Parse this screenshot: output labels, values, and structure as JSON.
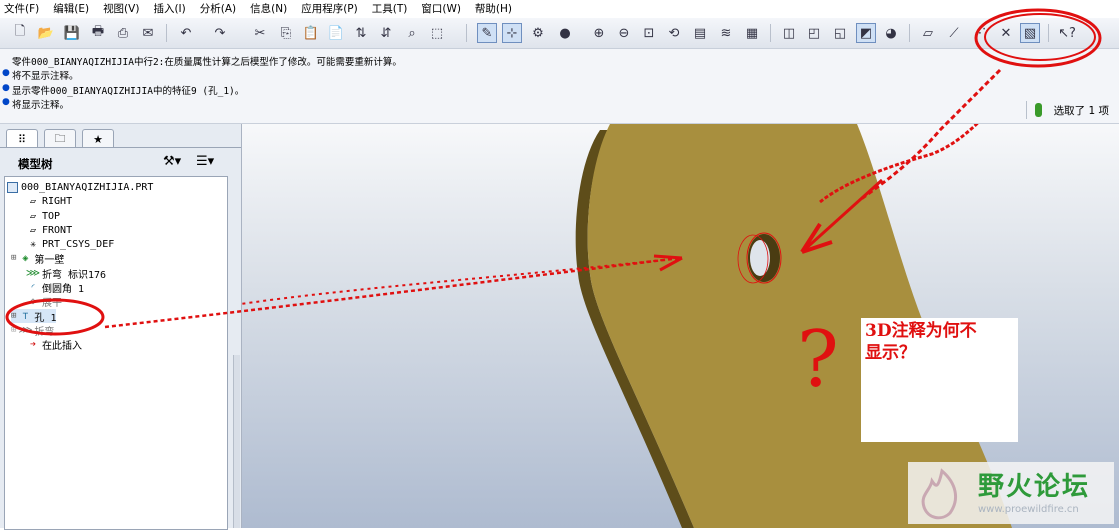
{
  "menu": [
    "文件(F)",
    "编辑(E)",
    "视图(V)",
    "插入(I)",
    "分析(A)",
    "信息(N)",
    "应用程序(P)",
    "工具(T)",
    "窗口(W)",
    "帮助(H)"
  ],
  "messages": [
    "零件000_BIANYAQIZHIJIA中行2:在质量属性计算之后模型作了修改。可能需要重新计算。",
    "将不显示注释。",
    "显示零件000_BIANYAQIZHIJIA中的特征9 (孔_1)。",
    "将显示注释。"
  ],
  "status": {
    "selected": "选取了 1 项"
  },
  "tree": {
    "title": "模型树",
    "items": [
      "000_BIANYAQIZHIJIA.PRT",
      "RIGHT",
      "TOP",
      "FRONT",
      "PRT_CSYS_DEF",
      "第一壁",
      "折弯 标识176",
      "倒圆角 1",
      "孔 1",
      "在此插入"
    ],
    "partial_items": [
      "展平",
      "折弯"
    ]
  },
  "annotation": {
    "callout": "3D注释为何不\n显示？",
    "question_mark": "?"
  },
  "watermark": {
    "brand": "野火论坛",
    "url": "www.proewildfire.cn"
  },
  "colors": {
    "part": "#a88f3e",
    "part_edge": "#5e4d1a",
    "annotation_red": "#e01010",
    "viewport_top": "#f7f8fa",
    "viewport_bottom": "#aebbd0"
  }
}
